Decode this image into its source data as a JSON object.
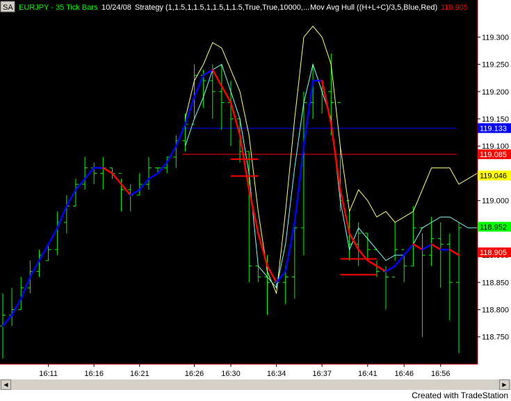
{
  "header": {
    "sa_badge": "SA",
    "symbol_title": "EURJPY - 35 Tick Bars",
    "date": "10/24/08",
    "strategy": "Strategy (1,1.5,1,1.5,1,1.5,1,1.5,True,True,10000,...",
    "indicator": "Mov Avg Hull ((H+L+C)/3,5,Blue,Red)",
    "indicator_value": "118.905"
  },
  "footer": {
    "created_with": "Created with TradeStation"
  },
  "controls": {
    "scroll_left": "◀",
    "scroll_right": "▶"
  },
  "colors": {
    "background": "#000000",
    "bars": "#00ff00",
    "hull_up": "#0000ff",
    "hull_down": "#ff0000",
    "upper_band": "#ffff80",
    "mid_band": "#80ffff",
    "strategy_levels": "#ff0000",
    "axis_panel": "#ffffff",
    "header_symbol": "#00ff00",
    "header_text": "#ffffff",
    "header_value": "#ff0000"
  },
  "chart_data": {
    "type": "line",
    "title": "EURJPY - 35 Tick Bars",
    "ylim": [
      118.705,
      119.34
    ],
    "x_ticks": [
      "16:11",
      "16:16",
      "16:21",
      "16:26",
      "16:30",
      "16:34",
      "16:37",
      "16:41",
      "16:46",
      "16:56"
    ],
    "y_ticks": [
      "119.300",
      "119.250",
      "119.200",
      "119.150",
      "119.100",
      "119.050",
      "119.000",
      "118.950",
      "118.900",
      "118.850",
      "118.800",
      "118.750"
    ],
    "price_labels": [
      {
        "text": "119.133",
        "value": 119.133,
        "bg": "#0000ff",
        "fg": "#ffffff"
      },
      {
        "text": "119.085",
        "value": 119.085,
        "bg": "#ff0000",
        "fg": "#ffffff"
      },
      {
        "text": "119.046",
        "value": 119.046,
        "bg": "#ffff00",
        "fg": "#000000"
      },
      {
        "text": "118.952",
        "value": 118.952,
        "bg": "#00ff00",
        "fg": "#000000"
      },
      {
        "text": "118.905",
        "value": 118.905,
        "bg": "#ff0000",
        "fg": "#ffffff"
      }
    ],
    "horizontal_lines": [
      {
        "value": 119.133,
        "color": "#0000ff"
      },
      {
        "value": 119.085,
        "color": "#ff0000"
      }
    ],
    "bars": [
      [
        118.83,
        118.71,
        118.77,
        118.79
      ],
      [
        118.84,
        118.77,
        118.79,
        118.8
      ],
      [
        118.86,
        118.8,
        118.8,
        118.84
      ],
      [
        118.89,
        118.83,
        118.84,
        118.87
      ],
      [
        118.91,
        118.86,
        118.87,
        118.9
      ],
      [
        118.92,
        118.89,
        118.89,
        118.91
      ],
      [
        118.98,
        118.9,
        118.91,
        118.96
      ],
      [
        119.01,
        118.94,
        118.96,
        118.99
      ],
      [
        119.04,
        118.99,
        118.99,
        119.03
      ],
      [
        119.08,
        119.02,
        119.03,
        119.06
      ],
      [
        119.07,
        119.03,
        119.06,
        119.05
      ],
      [
        119.08,
        119.02,
        119.05,
        119.06
      ],
      [
        119.06,
        119.04,
        119.06,
        119.05
      ],
      [
        119.04,
        118.98,
        119.05,
        119.02
      ],
      [
        119.03,
        118.98,
        119.02,
        119.01
      ],
      [
        119.05,
        119.01,
        119.01,
        119.03
      ],
      [
        119.08,
        119.02,
        119.03,
        119.06
      ],
      [
        119.06,
        119.05,
        119.06,
        119.06
      ],
      [
        119.08,
        119.05,
        119.06,
        119.08
      ],
      [
        119.12,
        119.06,
        119.08,
        119.11
      ],
      [
        119.16,
        119.09,
        119.11,
        119.14
      ],
      [
        119.25,
        119.15,
        119.14,
        119.23
      ],
      [
        119.24,
        119.17,
        119.23,
        119.22
      ],
      [
        119.25,
        119.15,
        119.22,
        119.2
      ],
      [
        119.25,
        119.13,
        119.2,
        119.18
      ],
      [
        119.22,
        119.1,
        119.18,
        119.15
      ],
      [
        119.15,
        119.07,
        119.15,
        119.09
      ],
      [
        119.09,
        118.85,
        119.09,
        118.88
      ],
      [
        118.88,
        118.85,
        118.88,
        118.86
      ],
      [
        118.9,
        118.79,
        118.86,
        118.85
      ],
      [
        118.85,
        118.84,
        118.85,
        118.85
      ],
      [
        118.88,
        118.81,
        118.85,
        118.86
      ],
      [
        118.96,
        118.82,
        118.86,
        118.95
      ],
      [
        119.2,
        118.9,
        118.95,
        119.18
      ],
      [
        119.25,
        119.15,
        119.18,
        119.22
      ],
      [
        119.21,
        119.16,
        119.22,
        119.2
      ],
      [
        119.27,
        119.12,
        119.2,
        119.18
      ],
      [
        119.1,
        118.98,
        119.18,
        119.0
      ],
      [
        118.98,
        118.89,
        119.0,
        118.92
      ],
      [
        118.96,
        118.88,
        118.92,
        118.94
      ],
      [
        118.94,
        118.89,
        118.94,
        118.91
      ],
      [
        118.89,
        118.86,
        118.91,
        118.87
      ],
      [
        118.88,
        118.8,
        118.87,
        118.86
      ],
      [
        118.96,
        118.89,
        118.86,
        118.91
      ],
      [
        118.9,
        118.85,
        118.91,
        118.88
      ],
      [
        118.99,
        118.88,
        118.88,
        118.95
      ],
      [
        118.94,
        118.75,
        118.95,
        118.9
      ],
      [
        118.97,
        118.88,
        118.9,
        118.93
      ],
      [
        118.96,
        118.84,
        118.93,
        118.92
      ],
      [
        118.94,
        118.78,
        118.92,
        118.85
      ],
      [
        118.96,
        118.72,
        118.85,
        118.95
      ]
    ],
    "upper_band": {
      "start_index": 20,
      "values": [
        119.15,
        119.22,
        119.25,
        119.29,
        119.28,
        119.24,
        119.2,
        119.12,
        118.98,
        118.87,
        118.83,
        118.98,
        119.15,
        119.3,
        119.32,
        119.3,
        119.25,
        119.1,
        118.98,
        119.02,
        119.0,
        118.97,
        118.98,
        118.96,
        118.97,
        118.98,
        119.02,
        119.06,
        119.06,
        119.06,
        119.03,
        119.04,
        119.05
      ]
    },
    "mid_band": {
      "start_index": 20,
      "values": [
        119.1,
        119.15,
        119.19,
        119.24,
        119.25,
        119.2,
        119.15,
        119.05,
        118.88,
        118.86,
        118.84,
        118.92,
        119.06,
        119.18,
        119.25,
        119.2,
        119.15,
        119.0,
        118.91,
        118.95,
        118.93,
        118.91,
        118.89,
        118.9,
        118.9,
        118.92,
        118.95,
        118.96,
        118.97,
        118.97,
        118.96,
        118.95,
        118.95
      ]
    },
    "hull": {
      "values": [
        118.77,
        118.79,
        118.82,
        118.86,
        118.89,
        118.92,
        118.95,
        118.99,
        119.02,
        119.04,
        119.06,
        119.06,
        119.05,
        119.03,
        119.01,
        119.02,
        119.04,
        119.05,
        119.07,
        119.1,
        119.14,
        119.19,
        119.23,
        119.24,
        119.21,
        119.18,
        119.12,
        119.02,
        118.94,
        118.88,
        118.85,
        118.87,
        118.96,
        119.1,
        119.22,
        119.22,
        119.14,
        119.02,
        118.94,
        118.91,
        118.89,
        118.88,
        118.87,
        118.88,
        118.9,
        118.92,
        118.91,
        118.92,
        118.91,
        118.91,
        118.9
      ]
    },
    "strategy_lines": [
      {
        "from_index": 25,
        "to_index": 28,
        "value": 119.076
      },
      {
        "from_index": 25,
        "to_index": 28,
        "value": 119.045
      },
      {
        "from_index": 37,
        "to_index": 41,
        "value": 118.893
      },
      {
        "from_index": 37,
        "to_index": 41,
        "value": 118.864
      }
    ]
  }
}
